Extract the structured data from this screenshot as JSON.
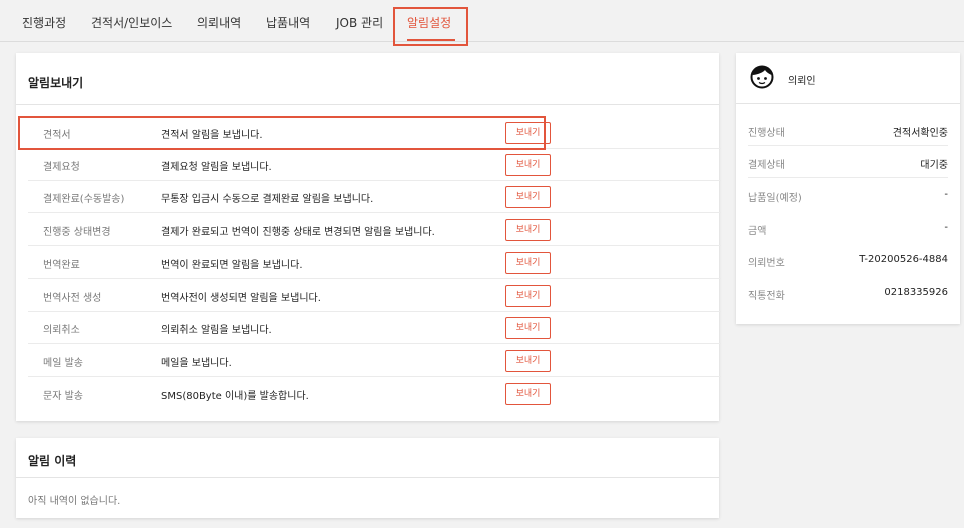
{
  "tabs": [
    {
      "label": "진행과정"
    },
    {
      "label": "견적서/인보이스"
    },
    {
      "label": "의뢰내역"
    },
    {
      "label": "납품내역"
    },
    {
      "label": "JOB 관리"
    },
    {
      "label": "알림설정"
    }
  ],
  "notifications": {
    "title": "알림보내기",
    "send_label": "보내기",
    "rows": [
      {
        "name": "견적서",
        "desc": "견적서 알림을 보냅니다."
      },
      {
        "name": "결제요청",
        "desc": "결제요청 알림을 보냅니다."
      },
      {
        "name": "결제완료(수동발송)",
        "desc": "무통장 입금시 수동으로 결제완료 알림을 보냅니다."
      },
      {
        "name": "진행중 상태변경",
        "desc": "결제가 완료되고 번역이 진행중 상태로 변경되면 알림을 보냅니다."
      },
      {
        "name": "번역완료",
        "desc": "번역이 완료되면 알림을 보냅니다."
      },
      {
        "name": "번역사전 생성",
        "desc": "번역사전이 생성되면 알림을 보냅니다."
      },
      {
        "name": "의뢰취소",
        "desc": "의뢰취소 알림을 보냅니다."
      },
      {
        "name": "메일 발송",
        "desc": "메일을 보냅니다."
      },
      {
        "name": "문자 발송",
        "desc": "SMS(80Byte 이내)를 발송합니다."
      }
    ]
  },
  "history": {
    "title": "알림 이력",
    "empty_text": "아직 내역이 없습니다."
  },
  "requester": {
    "label": "의뢰인",
    "avatar_icon": "face-icon",
    "info": [
      {
        "label": "진행상태",
        "value": "견적서확인중"
      },
      {
        "label": "결제상태",
        "value": "대기중"
      },
      {
        "label": "납품일(예정)",
        "value": "-"
      },
      {
        "label": "금액",
        "value": "-"
      },
      {
        "label": "의뢰번호",
        "value": "T-20200526-4884"
      },
      {
        "label": "직통전화",
        "value": "0218335926"
      }
    ]
  },
  "colors": {
    "accent": "#e2553c",
    "background": "#f2f2f2"
  }
}
